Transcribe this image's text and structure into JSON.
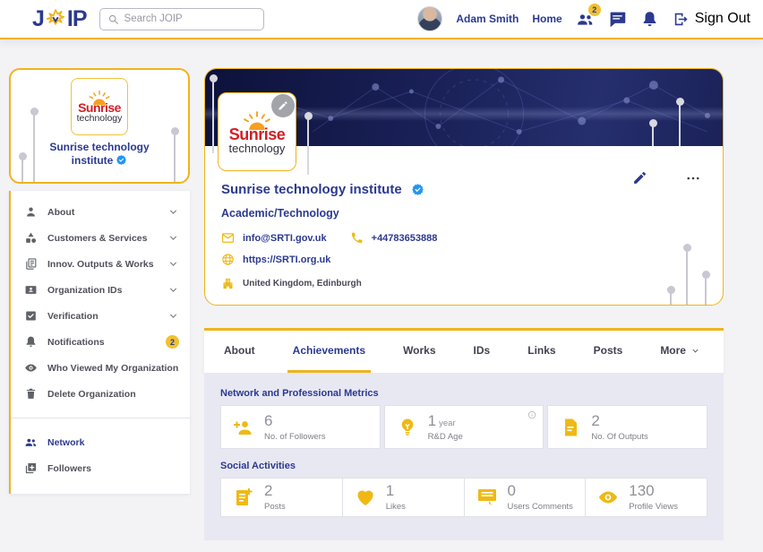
{
  "colors": {
    "navy": "#2b3990",
    "gold": "#f0b31d",
    "icon_gold": "#efb915",
    "lavender_bg": "#e8e8f2",
    "verified_blue": "#2196f3",
    "badge_yellow": "#f2c12e",
    "cover_navy": "#141a45"
  },
  "header": {
    "logo": {
      "left": "J",
      "right": "IP",
      "icon": "star"
    },
    "search": {
      "placeholder": "Search JOIP",
      "icon": "search"
    },
    "user": {
      "name": "Adam Smith"
    },
    "home_label": "Home",
    "network_badge": "2",
    "sign_out_label": "Sign Out"
  },
  "brand": {
    "line1": "Sunrise",
    "line2": "technology"
  },
  "sidebar": {
    "profile_card": {
      "org_name": "Sunrise technology institute",
      "verified": true
    },
    "menu": [
      {
        "icon": "person",
        "label": "About",
        "chevron": true
      },
      {
        "icon": "category",
        "label": "Customers & Services",
        "chevron": true
      },
      {
        "icon": "stack-doc",
        "label": "Innov. Outputs & Works",
        "chevron": true
      },
      {
        "icon": "id-badge",
        "label": "Organization IDs",
        "chevron": true
      },
      {
        "icon": "verify",
        "label": "Verification",
        "chevron": true
      },
      {
        "icon": "bell",
        "label": "Notifications",
        "badge": "2"
      },
      {
        "icon": "eye",
        "label": "Who Viewed My Organization"
      },
      {
        "icon": "trash",
        "label": "Delete Organization"
      }
    ],
    "secondary": [
      {
        "icon": "group",
        "label": "Network",
        "active": true
      },
      {
        "icon": "add-box",
        "label": "Followers"
      }
    ]
  },
  "profile": {
    "name": "Sunrise technology institute",
    "verified": true,
    "category": "Academic/Technology",
    "email": "info@SRTI.gov.uk",
    "phone": "+44783653888",
    "website": "https://SRTI.org.uk",
    "location": "United Kingdom, Edinburgh"
  },
  "tabs": [
    {
      "label": "About"
    },
    {
      "label": "Achievements",
      "active": true
    },
    {
      "label": "Works"
    },
    {
      "label": "IDs"
    },
    {
      "label": "Links"
    },
    {
      "label": "Posts"
    },
    {
      "label": "More",
      "chevron": true
    }
  ],
  "metrics": {
    "professional": {
      "title": "Network and Professional Metrics",
      "cards": [
        {
          "icon": "person-add",
          "value": "6",
          "label": "No. of Followers"
        },
        {
          "icon": "bulb",
          "value": "1",
          "unit": "year",
          "label": "R&D Age",
          "info": true
        },
        {
          "icon": "file-doc",
          "value": "2",
          "label": "No. Of Outputs"
        }
      ]
    },
    "social": {
      "title": "Social Activities",
      "cards": [
        {
          "icon": "post-add",
          "value": "2",
          "label": "Posts"
        },
        {
          "icon": "heart",
          "value": "1",
          "label": "Likes"
        },
        {
          "icon": "comment",
          "value": "0",
          "label": "Users Comments"
        },
        {
          "icon": "eye",
          "value": "130",
          "label": "Profile Views"
        }
      ]
    }
  }
}
